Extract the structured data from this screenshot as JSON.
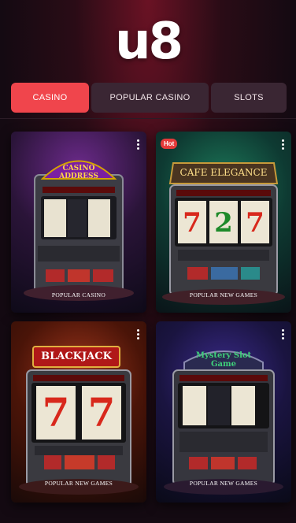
{
  "brand": {
    "logo_text": "u8"
  },
  "tabs": [
    {
      "label": "CASINO",
      "active": true
    },
    {
      "label": "POPULAR CASINO",
      "active": false
    },
    {
      "label": "SLOTS",
      "active": false
    }
  ],
  "cards": [
    {
      "sign": "CASINO ADDRESS",
      "caption": "POPULAR CASINO",
      "badge": ""
    },
    {
      "sign": "CAFE ELEGANCE",
      "caption": "POPULAR NEW GAMES",
      "badge": "Hot"
    },
    {
      "sign": "BLACKJACK",
      "caption": "POPULAR NEW GAMES",
      "badge": ""
    },
    {
      "sign": "Mystery Slot Game",
      "caption": "POPULAR NEW GAMES",
      "badge": ""
    }
  ],
  "reels": {
    "card2": [
      "7",
      "2",
      "7"
    ],
    "card3": [
      "7",
      "7"
    ]
  },
  "colors": {
    "accent": "#f0454c",
    "tab_dark": "#3a2633",
    "background": "#140a12"
  }
}
